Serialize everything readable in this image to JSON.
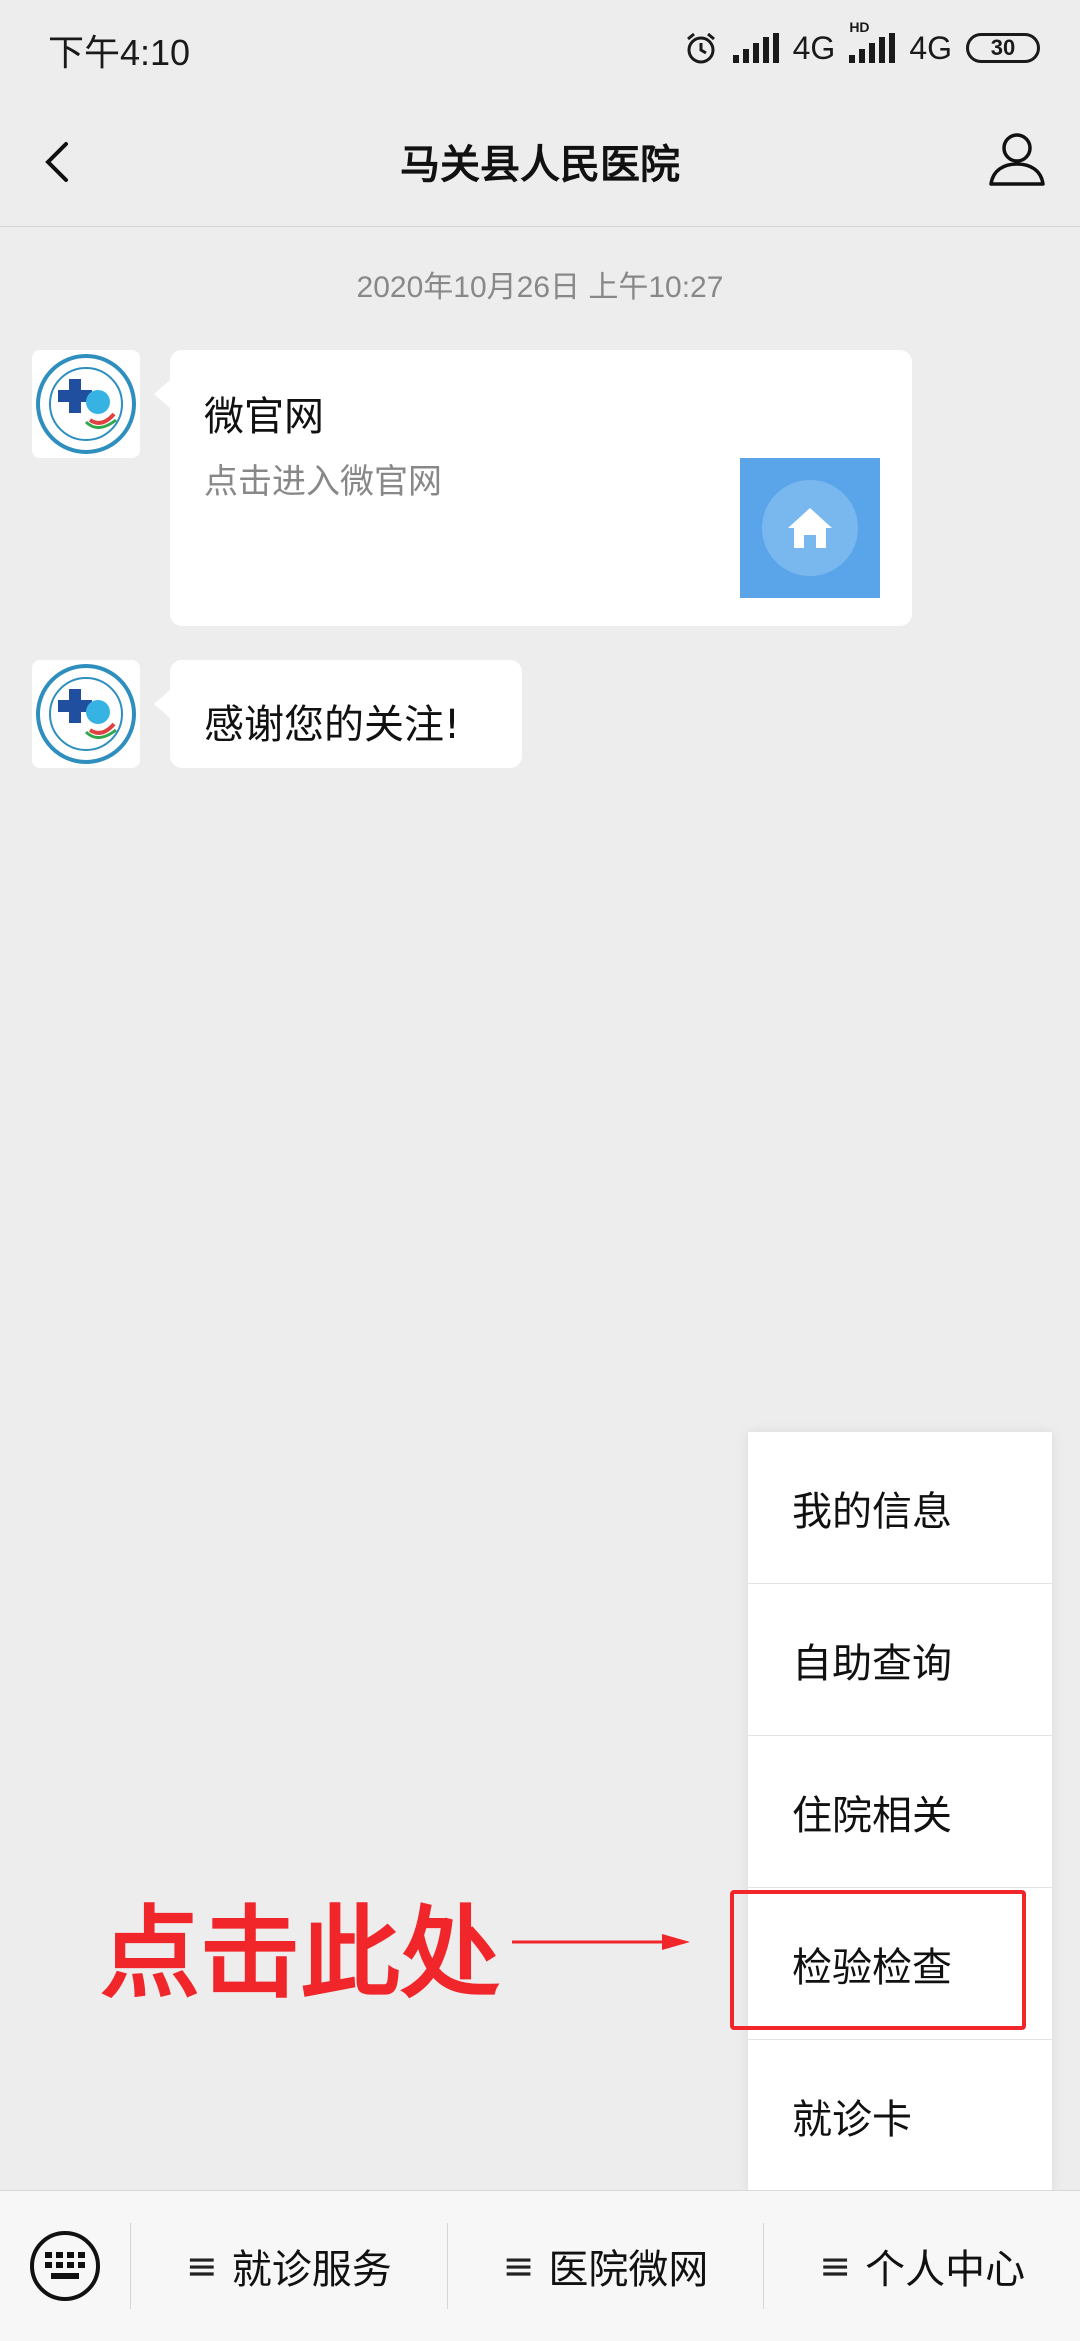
{
  "status_bar": {
    "time": "下午4:10",
    "network_1": "4G",
    "network_2": "4G",
    "hd_label": "HD",
    "battery": "30"
  },
  "header": {
    "title": "马关县人民医院"
  },
  "chat": {
    "timestamp": "2020年10月26日 上午10:27",
    "messages": [
      {
        "type": "card",
        "title": "微官网",
        "description": "点击进入微官网",
        "thumbnail_icon": "home-icon"
      },
      {
        "type": "text",
        "text": "感谢您的关注!"
      }
    ]
  },
  "popup_menu": {
    "items": [
      {
        "label": "我的信息"
      },
      {
        "label": "自助查询"
      },
      {
        "label": "住院相关"
      },
      {
        "label": "检验检查"
      },
      {
        "label": "就诊卡"
      }
    ]
  },
  "annotation": {
    "text": "点击此处",
    "color": "#f1262a"
  },
  "bottom_menu": {
    "keyboard_icon": "keyboard-icon",
    "tabs": [
      {
        "icon": "≡",
        "label": "就诊服务"
      },
      {
        "icon": "≡",
        "label": "医院微网"
      },
      {
        "icon": "≡",
        "label": "个人中心"
      }
    ]
  },
  "colors": {
    "background": "#ededed",
    "bubble": "#ffffff",
    "thumbnail": "#5aa5ea",
    "annotation_red": "#f1262a"
  }
}
